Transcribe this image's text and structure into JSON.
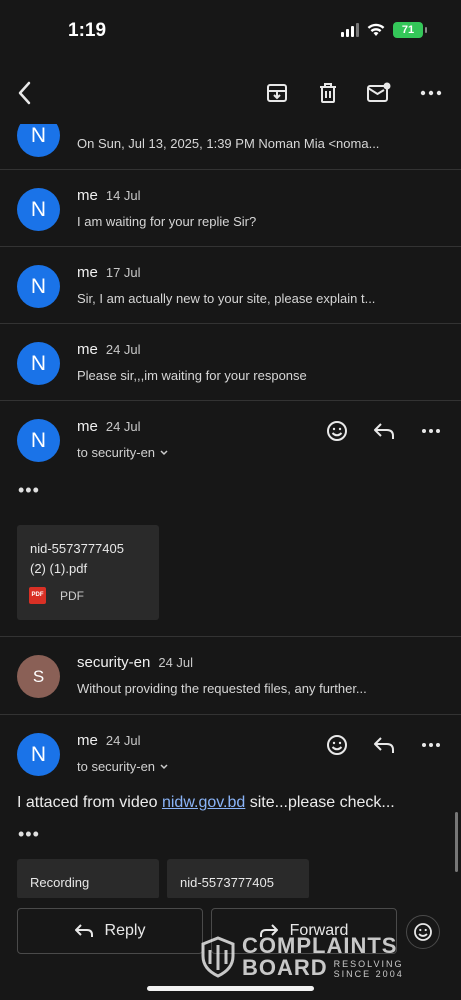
{
  "status": {
    "time": "1:19",
    "battery": "71"
  },
  "toolbar": {
    "back_icon": "chevron-left-icon",
    "archive_icon": "archive-icon",
    "delete_icon": "trash-icon",
    "mark_unread_icon": "mail-unread-icon",
    "more_icon": "more-horizontal-icon"
  },
  "messages": [
    {
      "avatar": "N",
      "sender": "me",
      "date": "",
      "snippet": "On Sun, Jul 13, 2025, 1:39 PM Noman Mia <noma..."
    },
    {
      "avatar": "N",
      "sender": "me",
      "date": "14 Jul",
      "snippet": "I am waiting for your replie Sir?"
    },
    {
      "avatar": "N",
      "sender": "me",
      "date": "17 Jul",
      "snippet": "Sir, I am actually new to your site, please explain t..."
    },
    {
      "avatar": "N",
      "sender": "me",
      "date": "24 Jul",
      "snippet": "Please sir,,,im waiting for your response"
    },
    {
      "avatar": "N",
      "sender": "me",
      "date": "24 Jul",
      "to": "to security-en",
      "ellipsis": "•••",
      "attachment": {
        "name_line1": "nid-5573777405",
        "name_line2": "(2) (1).pdf",
        "type_label": "PDF",
        "type_icon": "PDF"
      }
    },
    {
      "avatar": "S",
      "sender": "security-en",
      "date": "24 Jul",
      "snippet": "Without providing the requested files, any further..."
    },
    {
      "avatar": "N",
      "sender": "me",
      "date": "24 Jul",
      "to": "to security-en",
      "body_prefix": "I attaced from video ",
      "body_link": "nidw.gov.bd",
      "body_suffix": " site...please check...",
      "ellipsis": "•••",
      "attachments": [
        "Recording",
        "nid-5573777405"
      ]
    }
  ],
  "bottom": {
    "reply_label": "Reply",
    "forward_label": "Forward"
  },
  "watermark": {
    "line1": "COMPLAINTS",
    "line2": "BOARD",
    "sub1": "RESOLVING",
    "sub2": "SINCE 2004"
  }
}
